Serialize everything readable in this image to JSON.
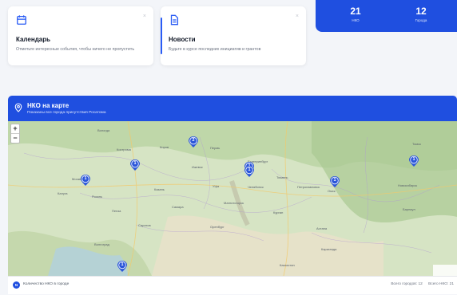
{
  "cards": [
    {
      "title": "Календарь",
      "desc": "Отметьте интересные события, чтобы ничего не пропустить",
      "icon": "calendar-icon",
      "close": "×"
    },
    {
      "title": "Новости",
      "desc": "Будьте в курсе последних инициатив и грантов",
      "icon": "document-icon",
      "close": "×"
    }
  ],
  "stats": [
    {
      "value": "21",
      "label": "НКО"
    },
    {
      "value": "12",
      "label": "Города"
    }
  ],
  "map_panel": {
    "title": "НКО на карте",
    "subtitle": "Показаны все города присутствия Росатома",
    "zoom_in": "+",
    "zoom_out": "−",
    "markers": [
      "1",
      "2",
      "1",
      "1",
      "1",
      "1",
      "1",
      "1"
    ],
    "place_labels": [
      "Вологда",
      "Кострома",
      "Пермь",
      "Екатеринбург",
      "Челябинск",
      "Тюмень",
      "Курган",
      "Петропавловск",
      "Омск",
      "Новосибирск",
      "Казань",
      "Уфа",
      "Самара",
      "Оренбург",
      "Волгоград",
      "Саратов",
      "Томск",
      "Барнаул",
      "Казахстан",
      "Астана",
      "Караганда",
      "Магнитогорск",
      "Ижевск",
      "Киров",
      "Калуга",
      "Москва",
      "Рязань",
      "Пенза"
    ]
  },
  "footer": {
    "badge": "N",
    "legend": "Количество НКО в городе",
    "cities_total": "Всего городов: 12",
    "nko_total": "Всего НКО: 21"
  },
  "colors": {
    "accent": "#1f4fe0",
    "marker": "#2b56d9"
  }
}
